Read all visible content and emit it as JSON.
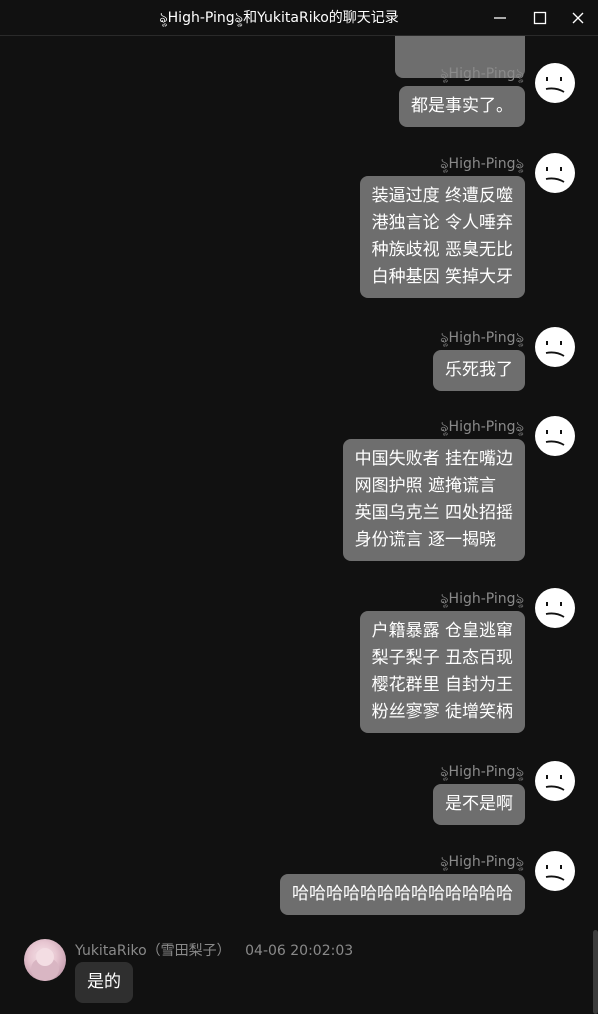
{
  "window": {
    "title": "ৡHigh-Pingৡ和YukitaRiko的聊天记录",
    "controls": {
      "minimize": "—",
      "maximize": "☐",
      "close": "✕"
    }
  },
  "sent_messages": [
    {
      "sender": "ৡHigh-Pingৡ",
      "text": "都是事实了。"
    },
    {
      "sender": "ৡHigh-Pingৡ",
      "text": "装逼过度 终遭反噬\n港独言论 令人唾弃\n种族歧视 恶臭无比\n白种基因 笑掉大牙"
    },
    {
      "sender": "ৡHigh-Pingৡ",
      "text": "乐死我了"
    },
    {
      "sender": "ৡHigh-Pingৡ",
      "text": "中国失败者 挂在嘴边\n网图护照 遮掩谎言\n英国乌克兰 四处招摇\n身份谎言 逐一揭晓"
    },
    {
      "sender": "ৡHigh-Pingৡ",
      "text": "户籍暴露 仓皇逃窜\n梨子梨子 丑态百现\n樱花群里 自封为王\n粉丝寥寥 徒增笑柄"
    },
    {
      "sender": "ৡHigh-Pingৡ",
      "text": "是不是啊"
    },
    {
      "sender": "ৡHigh-Pingৡ",
      "text": "哈哈哈哈哈哈哈哈哈哈哈哈哈"
    }
  ],
  "received_message": {
    "sender": "YukitaRiko（雪田梨子）",
    "time": "04-06 20:02:03",
    "text": "是的"
  },
  "colors": {
    "background": "#111111",
    "sent_bubble": "#6e6e6e",
    "received_bubble": "#2f2f2f",
    "name_text": "#8a8a8a"
  }
}
